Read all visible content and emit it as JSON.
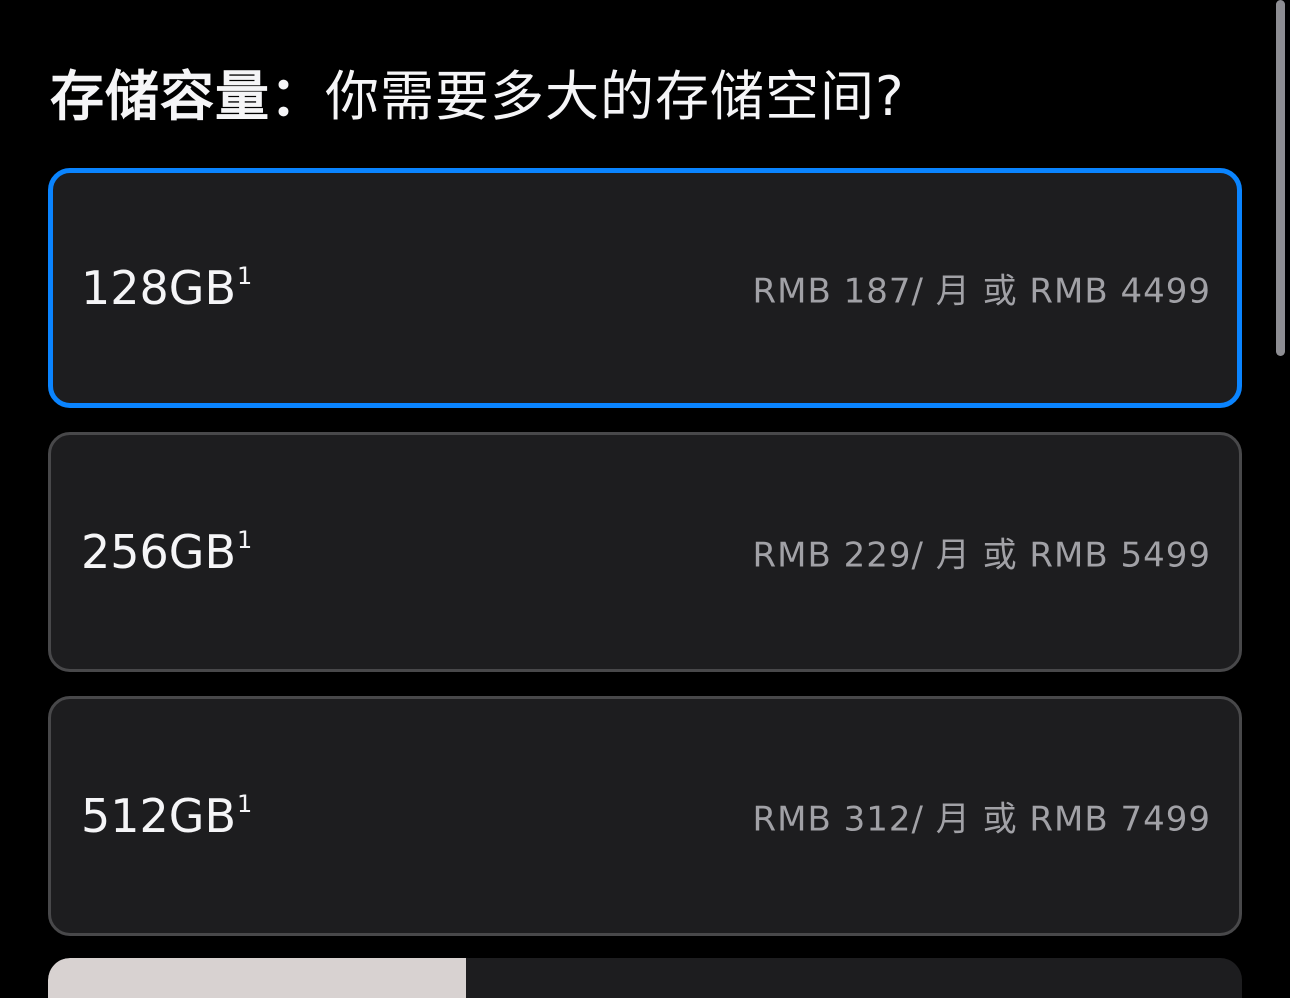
{
  "heading": {
    "lead": "存储容量：",
    "question": "你需要多大的存储空间?"
  },
  "options": [
    {
      "capacity": "128GB",
      "footnote": "1",
      "price": "RMB 187/ 月 或 RMB 4499",
      "selected": true
    },
    {
      "capacity": "256GB",
      "footnote": "1",
      "price": "RMB 229/ 月 或 RMB 5499",
      "selected": false
    },
    {
      "capacity": "512GB",
      "footnote": "1",
      "price": "RMB 312/ 月 或 RMB 7499",
      "selected": false
    }
  ],
  "colors": {
    "background": "#000000",
    "card": "#1d1d1f",
    "card_border": "#48484a",
    "selected_border": "#0a84ff",
    "price_text": "#a1a1a6"
  }
}
